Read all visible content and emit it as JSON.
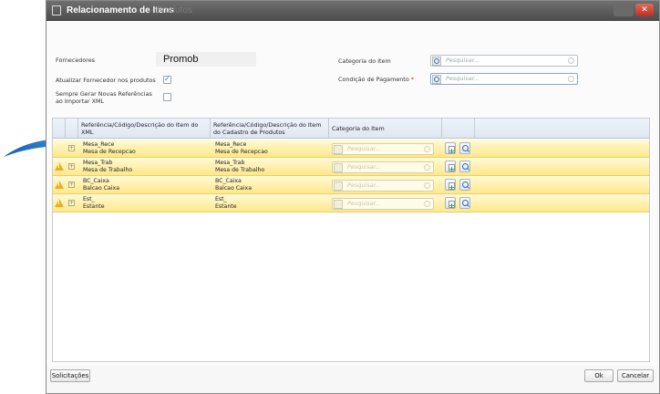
{
  "window": {
    "title": "Relacionamento de Itens",
    "title_ghost": "Produtos"
  },
  "form": {
    "fornecedores_label": "Fornecedores",
    "fornecedores_value": "Promob",
    "atualizar_label": "Atualizar Fornecedor nos produtos",
    "atualizar_checked": true,
    "sempre_gerar_label_1": "Sempre Gerar Novas Referências",
    "sempre_gerar_label_2": "ao Importar XML",
    "sempre_gerar_checked": false,
    "categoria_label": "Categoria do Item",
    "categoria_placeholder": "Pesquisar...",
    "condicao_label": "Condição de Pagamento",
    "condicao_required_mark": "*",
    "condicao_placeholder": "Pesquisar..."
  },
  "grid": {
    "columns": {
      "ref_xml_1": "Referência/Código/Descrição do Item do",
      "ref_xml_2": "XML",
      "ref_cad_1": "Referência/Código/Descrição do Item",
      "ref_cad_2": "do Cadastro de Produtos",
      "categoria": "Categoria do Item"
    },
    "row_search_placeholder": "Pesquisar...",
    "rows": [
      {
        "xml_code": "Mesa_Rece",
        "xml_desc": "Mesa de Recepcao",
        "cad_code": "Mesa_Rece",
        "cad_desc": "Mesa de Recepcao",
        "warning": false
      },
      {
        "xml_code": "Mesa_Trab",
        "xml_desc": "Mesa de Trabalho",
        "cad_code": "Mesa_Trab",
        "cad_desc": "Mesa de Trabalho",
        "warning": true
      },
      {
        "xml_code": "BC_Caixa",
        "xml_desc": "Balcao Caixa",
        "cad_code": "BC_Caixa",
        "cad_desc": "Balcao Caixa",
        "warning": true
      },
      {
        "xml_code": "Est_",
        "xml_desc": "Estante",
        "cad_code": "Est_",
        "cad_desc": "Estante",
        "warning": true
      }
    ]
  },
  "footer": {
    "solicitacoes_label": "Solicitações",
    "ok_label": "Ok",
    "cancelar_label": "Cancelar"
  },
  "colors": {
    "row_highlight": "#ffe88a",
    "arrow": "#2a7fc8",
    "titlebar": "#5a5a5a"
  }
}
